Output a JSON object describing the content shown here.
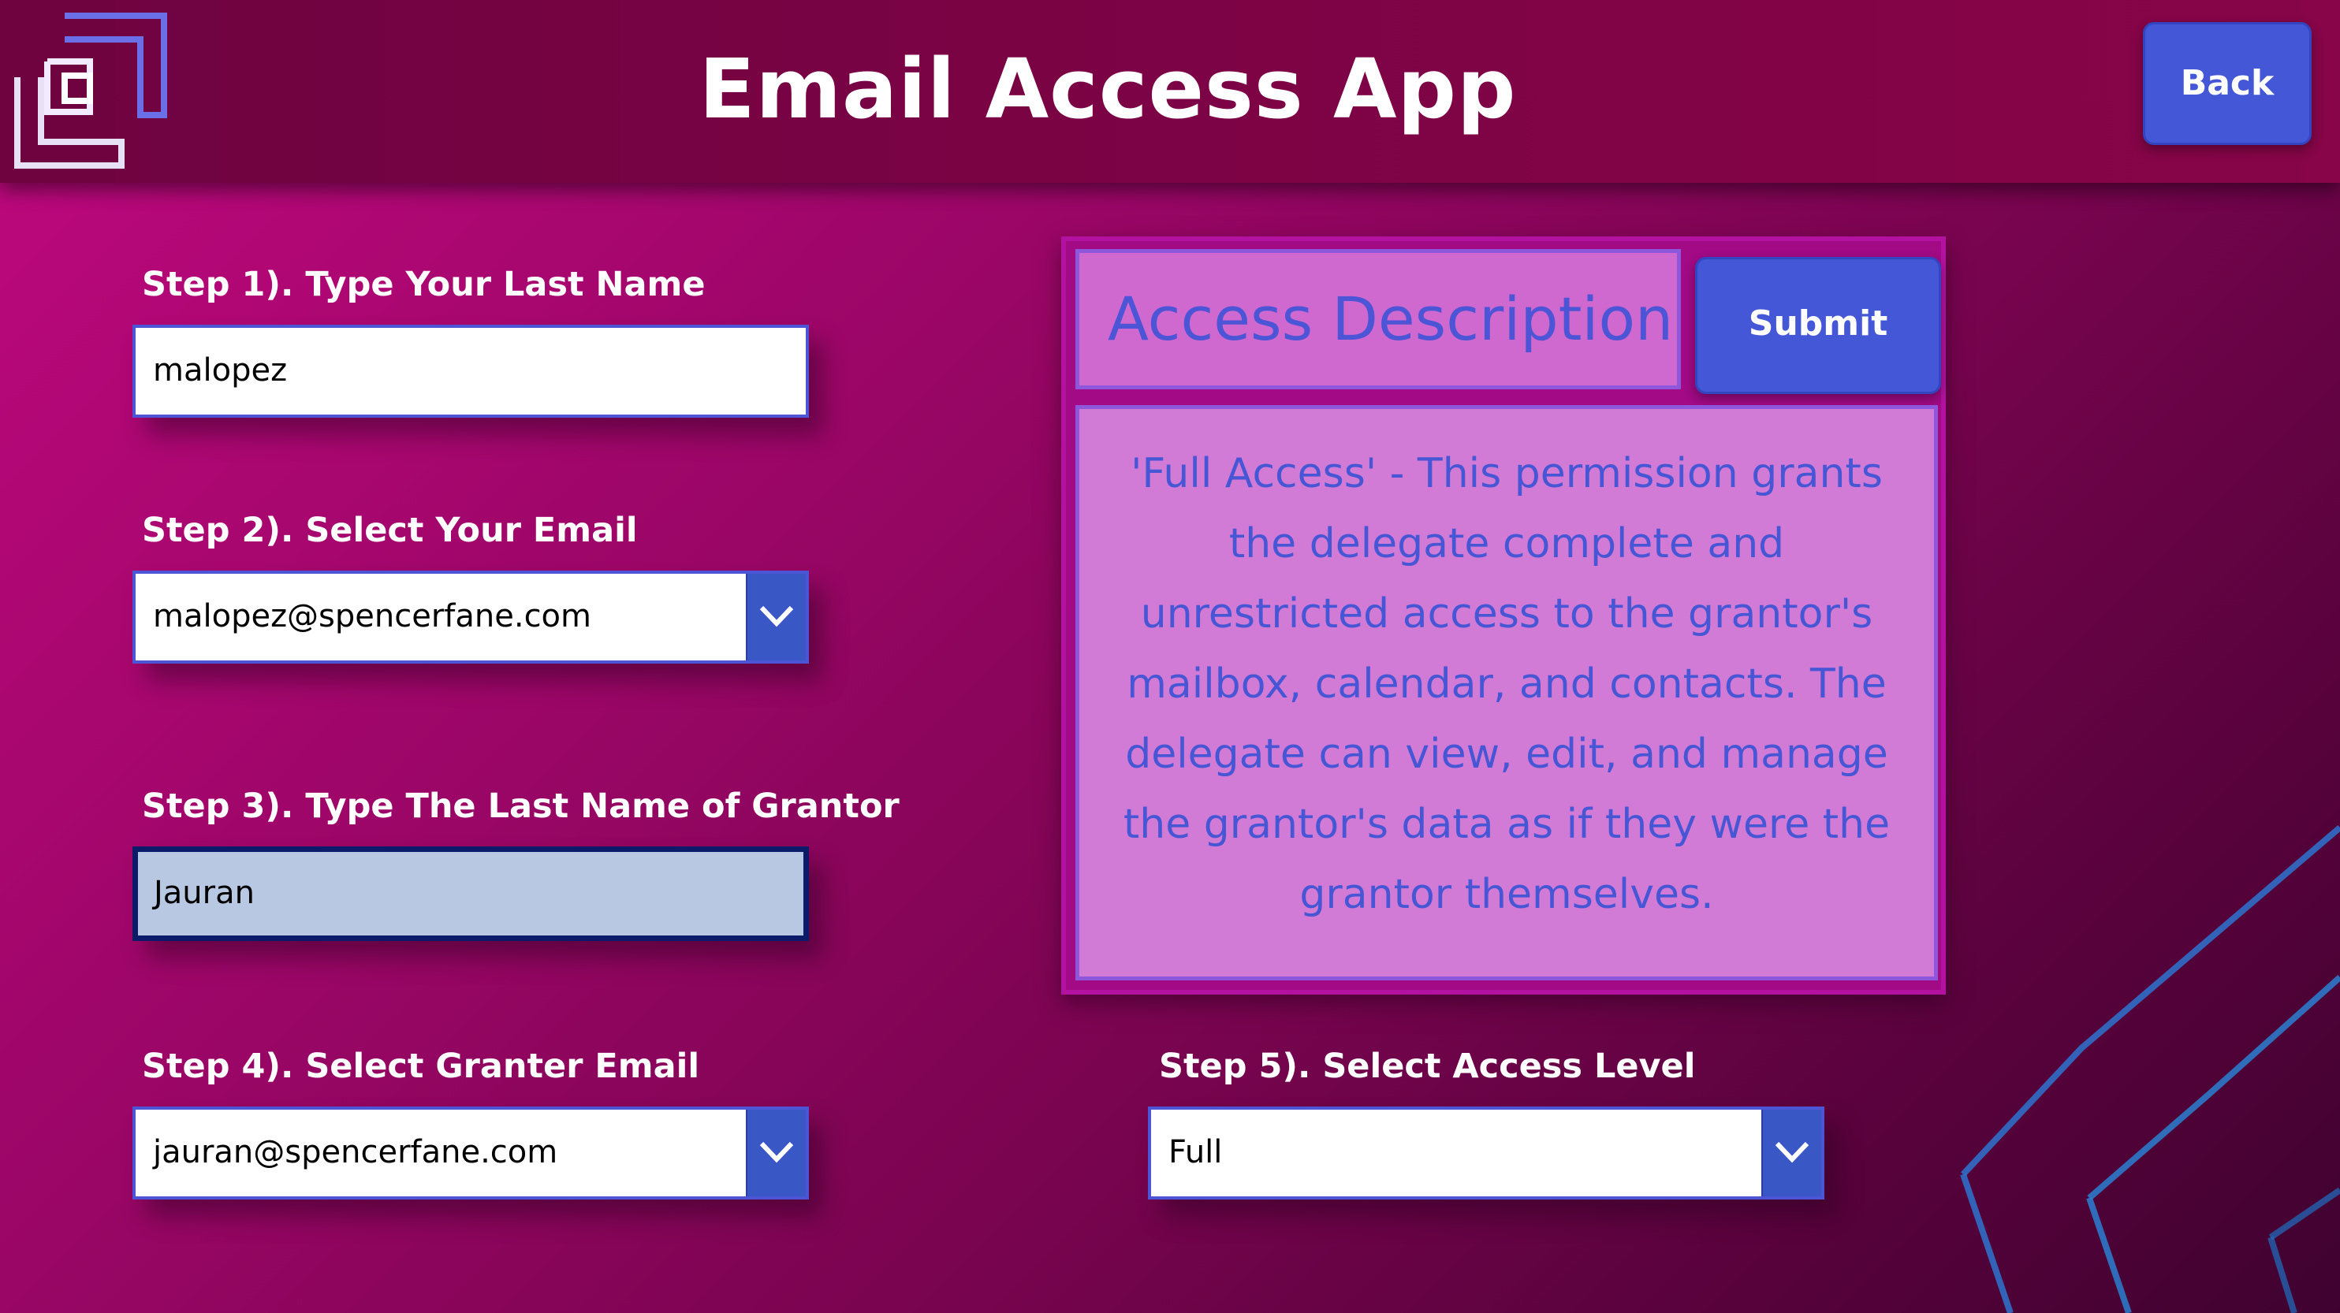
{
  "header": {
    "title": "Email Access App",
    "back_label": "Back"
  },
  "form": {
    "step1": {
      "label": "Step 1). Type Your Last Name",
      "value": "malopez"
    },
    "step2": {
      "label": "Step 2). Select Your Email",
      "value": "malopez@spencerfane.com"
    },
    "step3": {
      "label": "Step 3). Type The Last Name of Grantor",
      "value": "Jauran"
    },
    "step4": {
      "label": "Step 4). Select Granter Email",
      "value": "jauran@spencerfane.com"
    },
    "step5": {
      "label": "Step 5). Select Access Level",
      "value": "Full"
    }
  },
  "access_panel": {
    "title": "Access Description",
    "submit_label": "Submit",
    "description": "'Full Access' - This permission grants the delegate complete and unrestricted access to the grantor's mailbox, calendar, and contacts. The delegate can view, edit, and manage the grantor's data as if they were the grantor themselves."
  },
  "icons": [
    "logo-icon",
    "chevron-down-icon"
  ],
  "colors": {
    "accent": "#4457d6",
    "header": "#7c0345",
    "background": "#c0087f",
    "description_text": "#4756d4"
  }
}
